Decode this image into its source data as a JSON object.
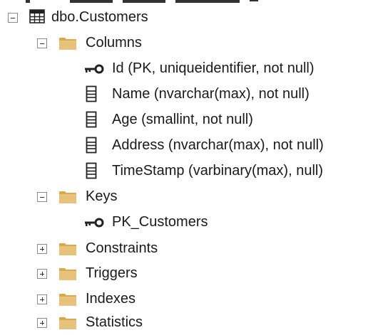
{
  "tree": {
    "table": {
      "label": "dbo.Customers",
      "icon": "table-icon",
      "expanded": true
    },
    "columns_folder": {
      "label": "Columns",
      "icon": "folder-icon",
      "expanded": true
    },
    "columns": [
      {
        "label": "Id (PK, uniqueidentifier, not null)",
        "icon": "key-icon"
      },
      {
        "label": "Name (nvarchar(max), not null)",
        "icon": "column-icon"
      },
      {
        "label": "Age (smallint, not null)",
        "icon": "column-icon"
      },
      {
        "label": "Address (nvarchar(max), not null)",
        "icon": "column-icon"
      },
      {
        "label": "TimeStamp (varbinary(max), null)",
        "icon": "column-icon"
      }
    ],
    "keys_folder": {
      "label": "Keys",
      "icon": "folder-icon",
      "expanded": true
    },
    "keys": [
      {
        "label": "PK_Customers",
        "icon": "key-icon"
      }
    ],
    "constraints_folder": {
      "label": "Constraints",
      "icon": "folder-icon",
      "expanded": false
    },
    "triggers_folder": {
      "label": "Triggers",
      "icon": "folder-icon",
      "expanded": false
    },
    "indexes_folder": {
      "label": "Indexes",
      "icon": "folder-icon",
      "expanded": false
    },
    "statistics_folder": {
      "label": "Statistics",
      "icon": "folder-icon",
      "expanded": false
    }
  },
  "colors": {
    "folder": "#e8c27a",
    "folder_tab": "#d9a94f",
    "text": "#1a1a1a",
    "toggle_border": "#8a8a8a"
  }
}
